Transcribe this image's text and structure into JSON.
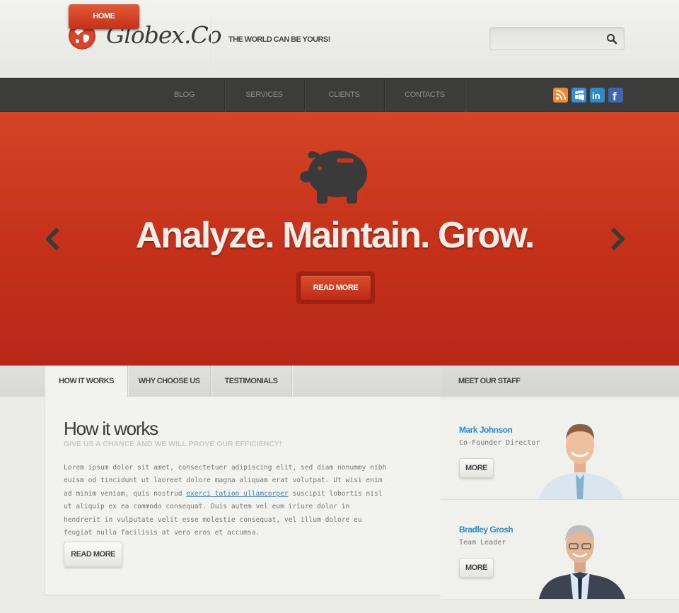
{
  "header": {
    "logo_text": "Globex.Co",
    "tagline": "THE WORLD CAN BE YOURS!",
    "search_placeholder": ""
  },
  "nav": {
    "items": [
      "HOME",
      "BLOG",
      "SERVICES",
      "CLIENTS",
      "CONTACTS"
    ],
    "social_icons": [
      "rss-icon",
      "myspace-icon",
      "linkedin-icon",
      "facebook-icon"
    ]
  },
  "hero": {
    "title": "Analyze. Maintain. Grow.",
    "button_label": "READ MORE",
    "icon": "piggy-bank-icon"
  },
  "tabs": {
    "items": [
      "HOW IT WORKS",
      "WHY CHOOSE US",
      "TESTIMONIALS"
    ],
    "active": "HOW IT WORKS"
  },
  "content": {
    "title": "How it works",
    "subtitle": "GIVE US A CHANCE AND WE WILL PROVE OUR EFFICIENCY!",
    "body_before_link": "Lorem ipsum dolor sit amet, consectetuer adipiscing elit, sed diam nonummy nibh euism od tincidunt ut laoreet dolore magna aliquam erat volutpat. Ut wisi enim ad minim veniam, quis nostrud ",
    "body_link": "exerci tation ullamcorper",
    "body_after_link": " suscipit lobortis nisl ut aliquip ex ea commodo consequat. Duis autem vel eum iriure dolor in hendrerit in vulputate velit esse molestie consequat, vel illum dolore eu feugiat nulla facilisis at vero eros et accumsa.",
    "button_label": "READ MORE"
  },
  "staff": {
    "heading": "MEET OUR STAFF",
    "members": [
      {
        "name": "Mark Johnson",
        "role": "Co-Founder Director",
        "button_label": "MORE"
      },
      {
        "name": "Bradley Grosh",
        "role": "Team Leader",
        "button_label": "MORE"
      }
    ]
  },
  "colors": {
    "accent": "#c9351c",
    "link": "#2a8ad6",
    "nav_bg": "#3c3c3b"
  }
}
